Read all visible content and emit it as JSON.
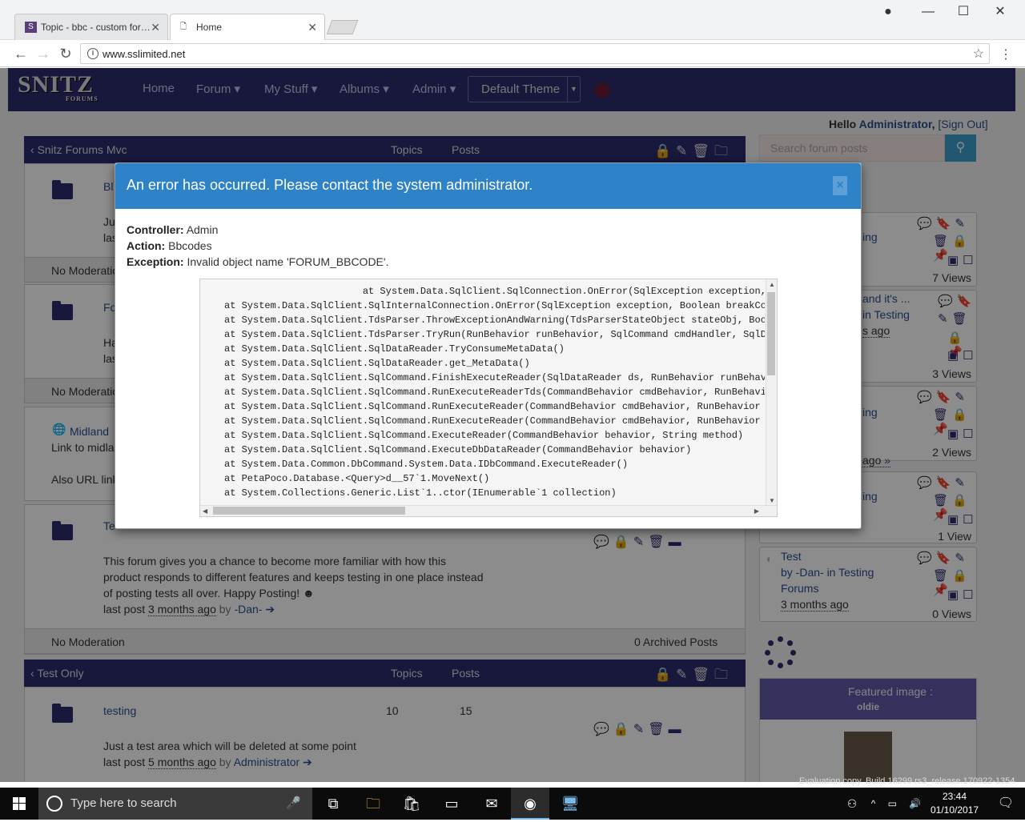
{
  "browser": {
    "tabs": [
      {
        "label": "Topic - bbc - custom for…",
        "icon": "snitz-favicon"
      },
      {
        "label": "Home",
        "icon": "page-icon"
      }
    ],
    "url": "www.sslimited.net"
  },
  "site": {
    "logo": "SNITZ",
    "logo_sub": "FORUMS",
    "nav": [
      "Home",
      "Forum",
      "My Stuff",
      "Albums",
      "Admin"
    ],
    "theme": "Default Theme",
    "hello_prefix": "Hello",
    "user": "Administrator",
    "signout": "[Sign Out]",
    "search_placeholder": "Search forum posts"
  },
  "main": {
    "category1": {
      "title": "Snitz Forums Mvc",
      "col_topics": "Topics",
      "col_posts": "Posts"
    },
    "forums": [
      {
        "name": "Bl",
        "desc": "Ju",
        "last": "las",
        "moderation": "No Moderatio"
      },
      {
        "name": "Fo",
        "desc": "Ha",
        "last": "las",
        "moderation": "No Moderatio"
      },
      {
        "name": "Midland",
        "desc": "Link to midla",
        "extra": "Also URL link"
      },
      {
        "name": "Te",
        "desc": "This forum gives you a chance to become more familiar with how this",
        "desc2": "product responds to different features and keeps testing in one place instead",
        "desc3": "of posting tests all over. Happy Posting!",
        "last_prefix": "last post",
        "last_time": "3 months ago",
        "last_by": "by",
        "last_user": "-Dan-",
        "moderation": "No Moderation",
        "archived": "0 Archived Posts"
      }
    ],
    "category2": {
      "title": "Test Only",
      "col_topics": "Topics",
      "col_posts": "Posts"
    },
    "testing": {
      "name": "testing",
      "topics": "10",
      "posts": "15",
      "desc": "Just a test area which will be deleted at some point",
      "last_prefix": "last post",
      "last_time": "5 months ago",
      "last_by": "by",
      "last_user": "Administrator"
    }
  },
  "sidebar": {
    "cards": [
      {
        "frag": "ing",
        "views": "7 Views"
      },
      {
        "frag1": "and it's ...",
        "frag2": "in Testing",
        "frag3": "s ago",
        "views": "3 Views"
      },
      {
        "frag": "ing",
        "frag2": "ago",
        "views": "2 Views"
      },
      {
        "frag": "ing",
        "views": "1 View"
      },
      {
        "title": "Test",
        "by": "by -Dan- in Testing",
        "forum": "Forums",
        "time": "3 months ago",
        "views": "0 Views"
      }
    ],
    "featured_title": "Featured image :",
    "featured_name": "oldie"
  },
  "modal": {
    "title": "An error has occurred. Please contact the system administrator.",
    "close": "×",
    "controller_label": "Controller:",
    "controller": "Admin",
    "action_label": "Action:",
    "action": "Bbcodes",
    "exception_label": "Exception:",
    "exception": "Invalid object name 'FORUM_BBCODE'.",
    "trace": [
      "                        at System.Data.SqlClient.SqlConnection.OnError(SqlException exception, ",
      "at System.Data.SqlClient.SqlInternalConnection.OnError(SqlException exception, Boolean breakCo",
      "at System.Data.SqlClient.TdsParser.ThrowExceptionAndWarning(TdsParserStateObject stateObj, Boo",
      "at System.Data.SqlClient.TdsParser.TryRun(RunBehavior runBehavior, SqlCommand cmdHandler, SqlD",
      "at System.Data.SqlClient.SqlDataReader.TryConsumeMetaData()",
      "at System.Data.SqlClient.SqlDataReader.get_MetaData()",
      "at System.Data.SqlClient.SqlCommand.FinishExecuteReader(SqlDataReader ds, RunBehavior runBehav",
      "at System.Data.SqlClient.SqlCommand.RunExecuteReaderTds(CommandBehavior cmdBehavior, RunBehavi",
      "at System.Data.SqlClient.SqlCommand.RunExecuteReader(CommandBehavior cmdBehavior, RunBehavior ",
      "at System.Data.SqlClient.SqlCommand.RunExecuteReader(CommandBehavior cmdBehavior, RunBehavior ",
      "at System.Data.SqlClient.SqlCommand.ExecuteReader(CommandBehavior behavior, String method)",
      "at System.Data.SqlClient.SqlCommand.ExecuteDbDataReader(CommandBehavior behavior)",
      "at System.Data.Common.DbCommand.System.Data.IDbCommand.ExecuteReader()",
      "at PetaPoco.Database.<Query>d__57`1.MoveNext()",
      "at System.Collections.Generic.List`1..ctor(IEnumerable`1 collection)"
    ]
  },
  "taskbar": {
    "search_placeholder": "Type here to search",
    "time": "23:44",
    "date": "01/10/2017",
    "watermark": "Evaluation copy. Build 16299.rs3_release.170922-1354"
  },
  "colors": {
    "nav_bg": "#2d2a6e",
    "modal_header": "#2d82c8",
    "search_btn": "#3c9fce"
  }
}
